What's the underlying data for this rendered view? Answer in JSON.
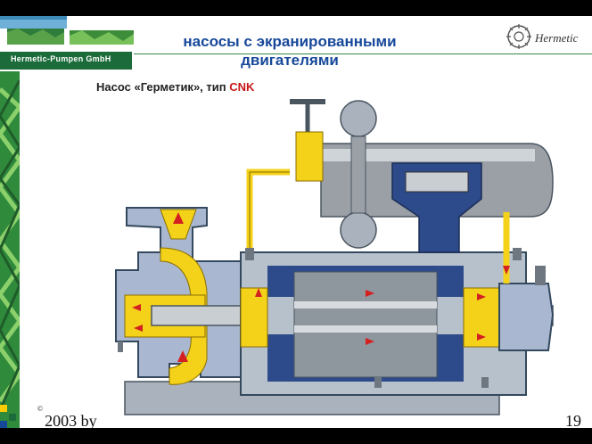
{
  "slide": {
    "brand": "Hermetic-Pumpen GmbH",
    "title": "насосы с экранированными двигателями",
    "subtitle_main": "Насос «Герметик», тип",
    "subtitle_accent": "CNK",
    "logo_text": "Hermetic",
    "footer_left": "2003 by",
    "footer_symbol": "©",
    "page_number": "19"
  },
  "colors": {
    "title": "#16489a",
    "accent": "#c81818",
    "brand_green": "#1c6b3a",
    "flow_yellow": "#f4d21a",
    "flow_arrow": "#d42020",
    "casing_blue": "#2d4a8a",
    "metal_gray": "#9aa0a6"
  }
}
